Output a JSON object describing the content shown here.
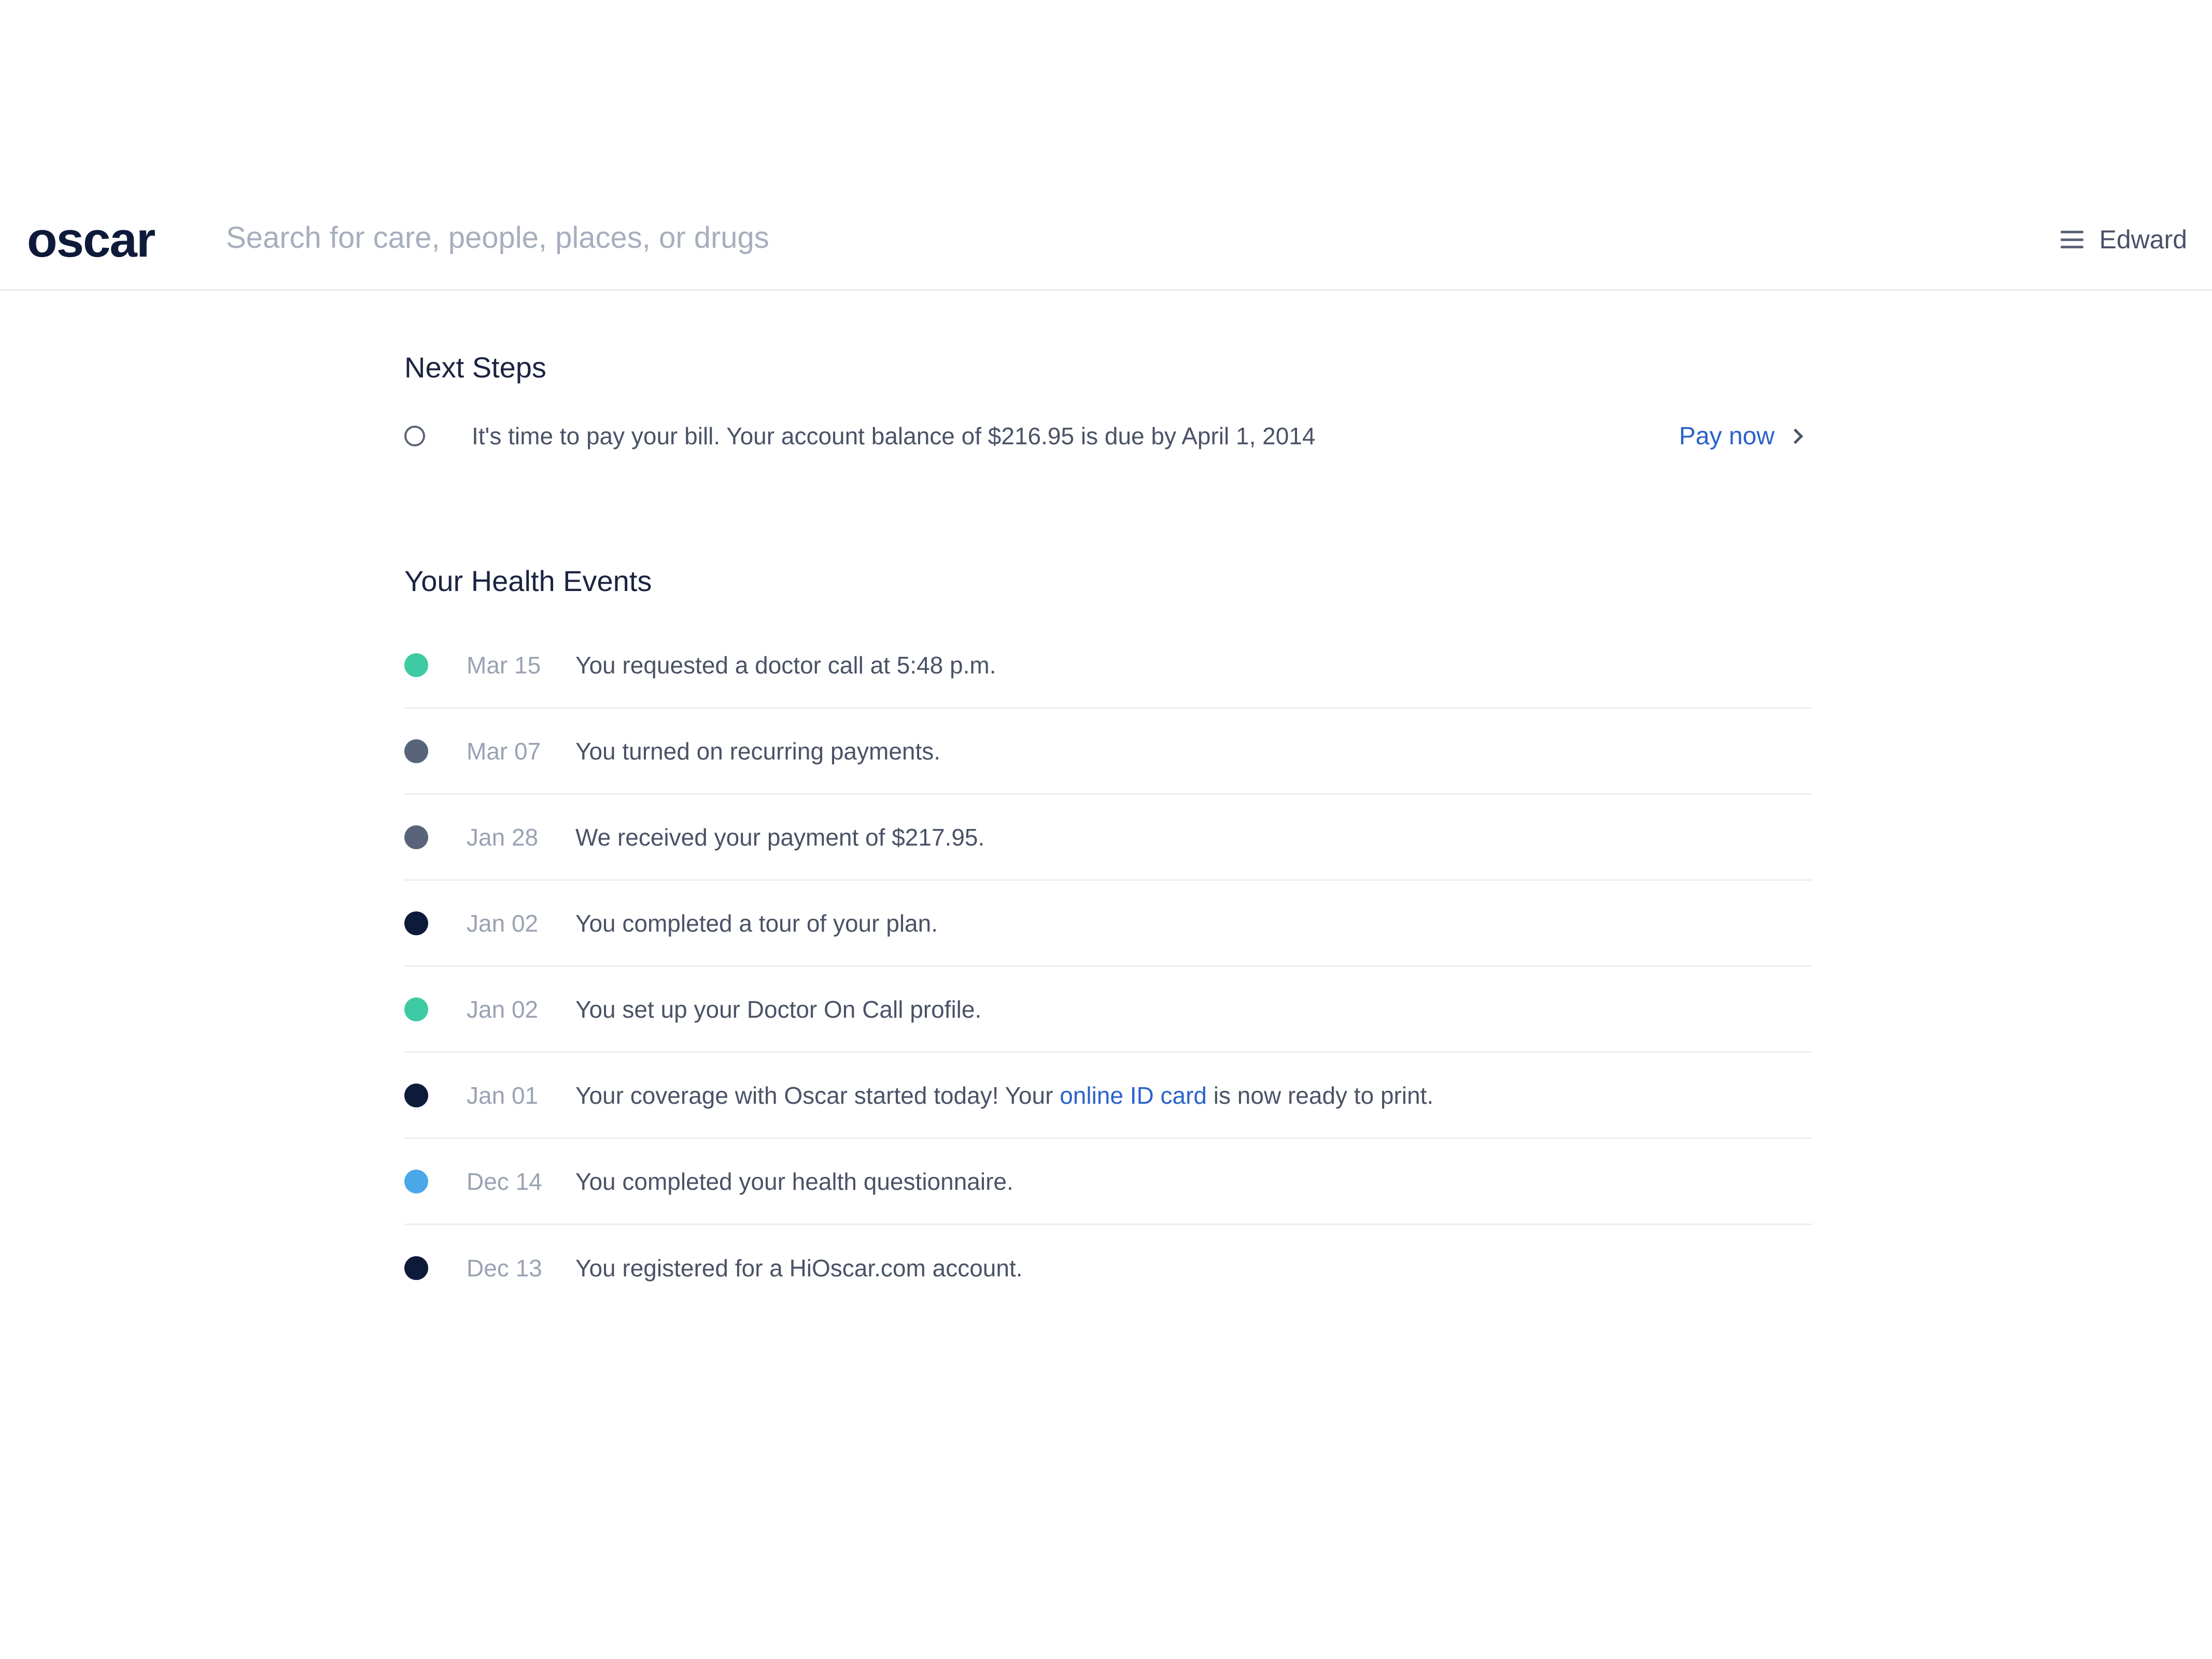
{
  "header": {
    "logo_text": "oscar",
    "search_placeholder": "Search for care, people, places, or drugs",
    "user_name": "Edward",
    "menu_icon": "hamburger-menu-icon"
  },
  "next_steps": {
    "title": "Next Steps",
    "items": [
      {
        "text": "It's time to pay your bill. Your account balance of $216.95 is due by April 1, 2014",
        "action_label": "Pay now",
        "action_icon": "chevron-right-icon"
      }
    ]
  },
  "health_events": {
    "title": "Your Health Events",
    "items": [
      {
        "date": "Mar 15",
        "text": "You requested a doctor call at 5:48 p.m.",
        "dot_color": "#3ecba4"
      },
      {
        "date": "Mar 07",
        "text": "You turned on recurring payments.",
        "dot_color": "#59647a"
      },
      {
        "date": "Jan 28",
        "text": "We received your payment of $217.95.",
        "dot_color": "#59647a"
      },
      {
        "date": "Jan 02",
        "text": "You completed a tour of your plan.",
        "dot_color": "#0d1a3a"
      },
      {
        "date": "Jan 02",
        "text": "You set up your Doctor On Call profile.",
        "dot_color": "#3ecba4"
      },
      {
        "date": "Jan 01",
        "text_before": "Your coverage with Oscar started today! Your ",
        "link_text": "online ID card",
        "text_after": " is now ready to print.",
        "dot_color": "#0d1a3a"
      },
      {
        "date": "Dec 14",
        "text": "You completed your health questionnaire.",
        "dot_color": "#4aa8e8"
      },
      {
        "date": "Dec 13",
        "text": "You registered for a HiOscar.com account.",
        "dot_color": "#0d1a3a"
      }
    ]
  },
  "colors": {
    "link": "#2a62c9",
    "text": "#4a5266",
    "heading": "#1b2440",
    "date": "#9aa2b3"
  }
}
